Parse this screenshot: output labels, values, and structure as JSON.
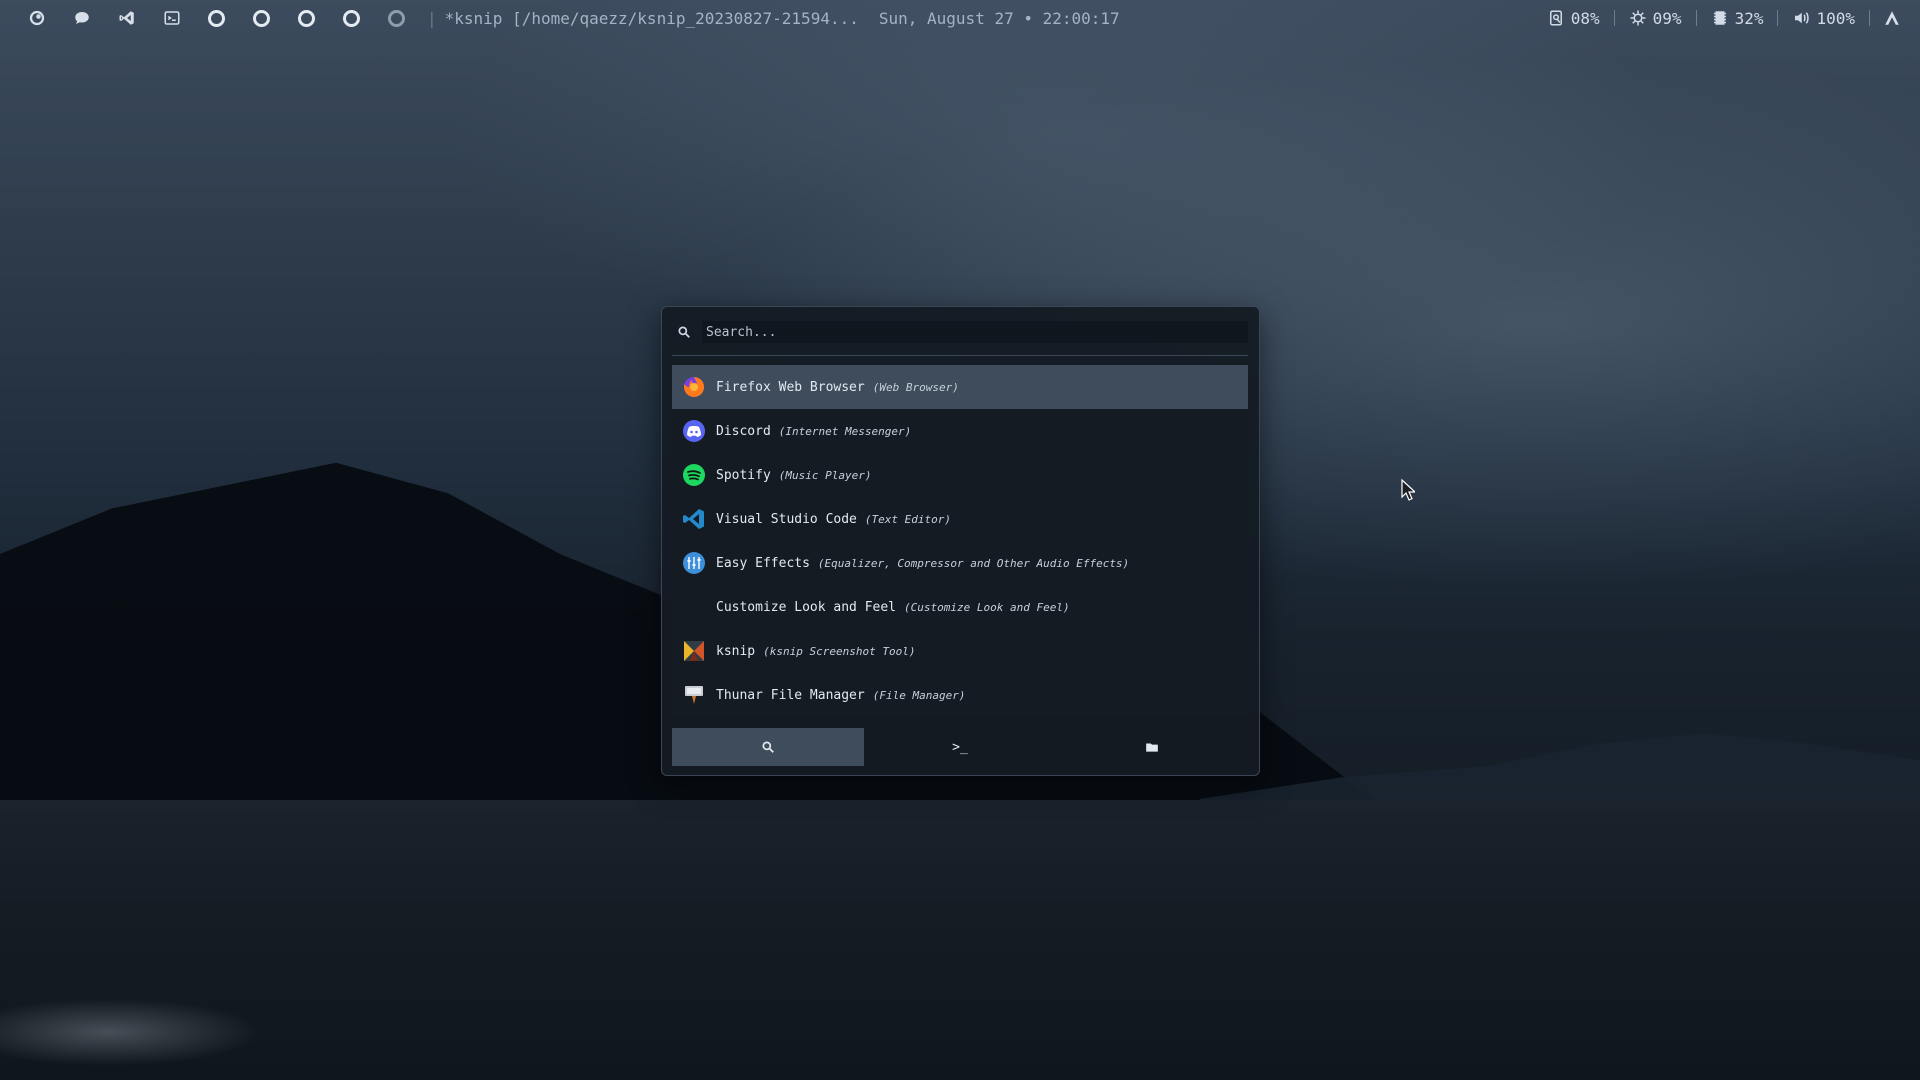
{
  "topbar": {
    "left_icons": [
      "arch-logo-icon",
      "chat-bubble-icon",
      "vscode-icon",
      "terminal-icon"
    ],
    "workspaces": [
      {
        "state": "active"
      },
      {
        "state": "active"
      },
      {
        "state": "active"
      },
      {
        "state": "active"
      },
      {
        "state": "dim"
      }
    ],
    "separator": "|",
    "window_title": "*ksnip [/home/qaezz/ksnip_20230827-21594...",
    "clock": "Sun, August 27 • 22:00:17",
    "stats": [
      {
        "icon": "disk-icon",
        "value": "08%"
      },
      {
        "icon": "cpu-icon",
        "value": "09%"
      },
      {
        "icon": "memory-icon",
        "value": "32%"
      },
      {
        "icon": "volume-icon",
        "value": "100%"
      }
    ],
    "right_icon": "arch-a-icon"
  },
  "launcher": {
    "search": {
      "placeholder": "Search...",
      "value": ""
    },
    "items": [
      {
        "name": "Firefox Web Browser",
        "desc": "(Web Browser)",
        "icon": "firefox-icon",
        "selected": true
      },
      {
        "name": "Discord",
        "desc": "(Internet Messenger)",
        "icon": "discord-icon",
        "selected": false
      },
      {
        "name": "Spotify",
        "desc": "(Music Player)",
        "icon": "spotify-icon",
        "selected": false
      },
      {
        "name": "Visual Studio Code",
        "desc": "(Text Editor)",
        "icon": "vscode-icon",
        "selected": false
      },
      {
        "name": "Easy Effects",
        "desc": "(Equalizer, Compressor and Other Audio Effects)",
        "icon": "easyeffects-icon",
        "selected": false
      },
      {
        "name": "Customize Look and Feel",
        "desc": "(Customize Look and Feel)",
        "icon": "none",
        "selected": false
      },
      {
        "name": "ksnip",
        "desc": "(ksnip Screenshot Tool)",
        "icon": "ksnip-icon",
        "selected": false
      },
      {
        "name": "Thunar File Manager",
        "desc": "(File Manager)",
        "icon": "thunar-icon",
        "selected": false
      }
    ],
    "tabs": [
      {
        "icon": "search-icon",
        "label": "",
        "active": true
      },
      {
        "icon": "terminal-prompt-icon",
        "label": ">_",
        "active": false
      },
      {
        "icon": "folder-icon",
        "label": "",
        "active": false
      }
    ]
  },
  "colors": {
    "accent": "#3e4c5c",
    "panel_bg": "#141b23",
    "text": "#e3e9f0"
  }
}
